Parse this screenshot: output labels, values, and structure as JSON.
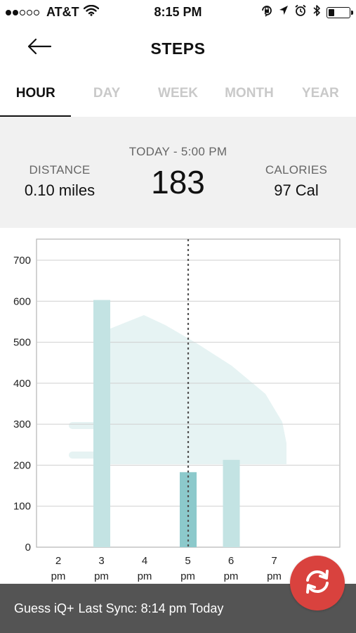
{
  "status_bar": {
    "carrier": "AT&T",
    "time": "8:15 PM",
    "signal_bars_filled": 2,
    "signal_bars_total": 5,
    "battery_level": 0.3,
    "icons": [
      "wifi-icon",
      "lock-rotation-icon",
      "location-icon",
      "alarm-icon",
      "bluetooth-icon",
      "battery-icon"
    ]
  },
  "header": {
    "title": "STEPS",
    "back_icon": "arrow-left-icon"
  },
  "tabs": [
    {
      "label": "HOUR",
      "active": true
    },
    {
      "label": "DAY",
      "active": false
    },
    {
      "label": "WEEK",
      "active": false
    },
    {
      "label": "MONTH",
      "active": false
    },
    {
      "label": "YEAR",
      "active": false
    }
  ],
  "summary": {
    "distance_label": "DISTANCE",
    "distance_value": "0.10 miles",
    "time_label": "TODAY - 5:00 PM",
    "steps_value": "183",
    "calories_label": "CALORIES",
    "calories_value": "97 Cal"
  },
  "chart_data": {
    "type": "bar",
    "categories": [
      "2 pm",
      "3 pm",
      "4 pm",
      "5 pm",
      "6 pm",
      "7 pm"
    ],
    "values": [
      0,
      603,
      0,
      183,
      213,
      0
    ],
    "selected_index": 3,
    "ylim": [
      0,
      700
    ],
    "yticks": [
      0,
      100,
      200,
      300,
      400,
      500,
      600,
      700
    ],
    "grid": true,
    "colors": {
      "bar": "#c3e3e3",
      "selected_bar": "#8cc9cb",
      "grid": "#cfcfcf",
      "watermark": "#e6f3f3"
    }
  },
  "footer": {
    "device": "Guess iQ+",
    "sync_text": "Last Sync: 8:14 pm Today"
  },
  "sync_button": {
    "icon": "sync-icon",
    "color": "#d9423e"
  }
}
